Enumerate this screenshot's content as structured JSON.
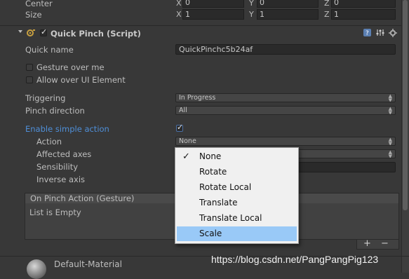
{
  "transform": {
    "center_label": "Center",
    "size_label": "Size",
    "center": {
      "x": "0",
      "y": "0",
      "z": "0"
    },
    "size": {
      "x": "1",
      "y": "1",
      "z": "1"
    },
    "axis_x": "X",
    "axis_y": "Y",
    "axis_z": "Z"
  },
  "component": {
    "title": "Quick Pinch (Script)",
    "enabled": true
  },
  "fields": {
    "quick_name_label": "Quick name",
    "quick_name_value": "QuickPinchc5b24af",
    "gesture_over_me_label": "Gesture over me",
    "allow_over_ui_label": "Allow over UI Element",
    "triggering_label": "Triggering",
    "triggering_value": "In Progress",
    "pinch_direction_label": "Pinch direction",
    "pinch_direction_value": "All",
    "enable_simple_action_label": "Enable simple action",
    "enable_simple_action_checked": true,
    "action_label": "Action",
    "action_value": "None",
    "affected_axes_label": "Affected axes",
    "sensibility_label": "Sensibility",
    "inverse_axis_label": "Inverse axis"
  },
  "event_panel": {
    "title": "On Pinch Action (Gesture)",
    "empty_text": "List is Empty",
    "add": "+",
    "remove": "−"
  },
  "popup": {
    "items": [
      "None",
      "Rotate",
      "Rotate Local",
      "Translate",
      "Translate Local",
      "Scale"
    ],
    "checked": "None",
    "highlighted": "Scale"
  },
  "material": {
    "name": "Default-Material"
  },
  "watermark": "https://blog.csdn.net/PangPangPig123"
}
